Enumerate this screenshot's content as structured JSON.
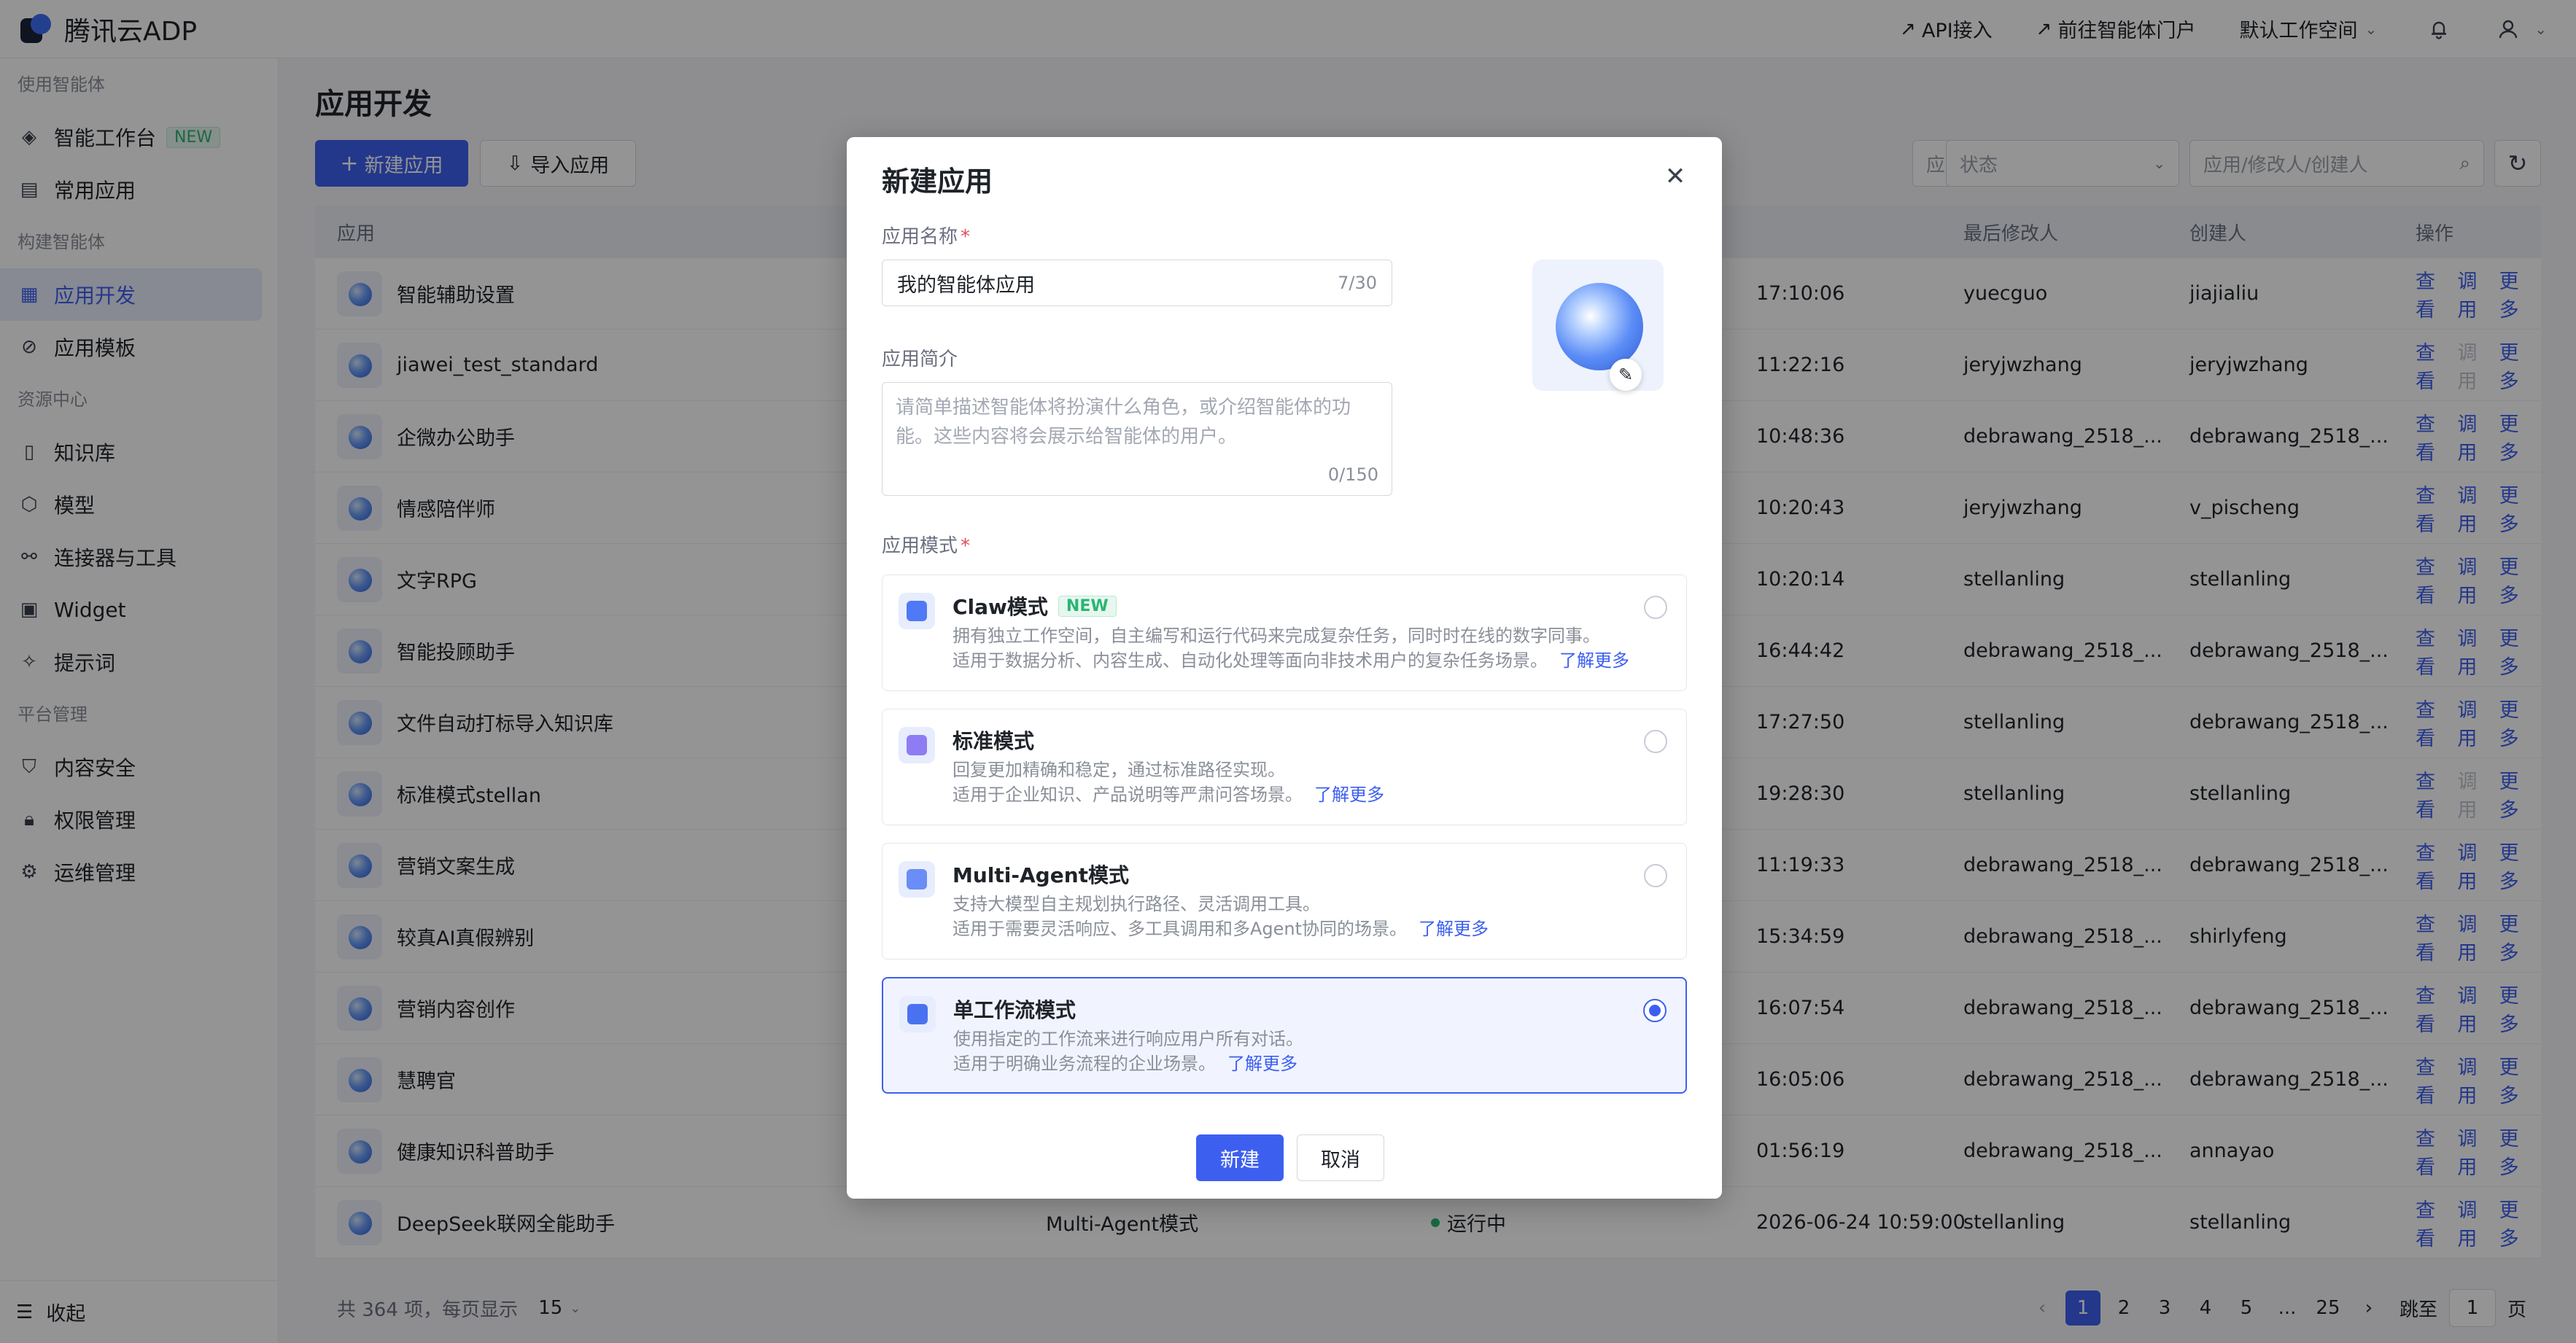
{
  "brand": {
    "name": "腾讯云ADP"
  },
  "topbar": {
    "api_link": "API接入",
    "portal_link": "前往智能体门户",
    "workspace": "默认工作空间"
  },
  "sidebar": {
    "sections": [
      {
        "title": "使用智能体",
        "items": [
          {
            "label": "智能工作台",
            "badge": "NEW",
            "icon": "workbench-icon"
          },
          {
            "label": "常用应用",
            "icon": "list-icon"
          }
        ]
      },
      {
        "title": "构建智能体",
        "items": [
          {
            "label": "应用开发",
            "icon": "grid-icon",
            "active": true
          },
          {
            "label": "应用模板",
            "icon": "template-icon"
          }
        ]
      },
      {
        "title": "资源中心",
        "items": [
          {
            "label": "知识库",
            "icon": "book-icon"
          },
          {
            "label": "模型",
            "icon": "cube-icon"
          },
          {
            "label": "连接器与工具",
            "icon": "link-icon"
          },
          {
            "label": "Widget",
            "icon": "widget-icon"
          },
          {
            "label": "提示词",
            "icon": "sparkle-icon"
          }
        ]
      },
      {
        "title": "平台管理",
        "items": [
          {
            "label": "内容安全",
            "icon": "shield-icon"
          },
          {
            "label": "权限管理",
            "icon": "lock-icon"
          },
          {
            "label": "运维管理",
            "icon": "gear-icon"
          }
        ]
      }
    ],
    "collapse_label": "收起"
  },
  "main": {
    "title": "应用开发",
    "new_app_button": "新建应用",
    "import_button": "导入应用",
    "filter_mode_placeholder": "应用模式",
    "filter_status_placeholder": "状态",
    "search_placeholder": "应用/修改人/创建人",
    "columns": {
      "app": "应用",
      "last_modifier": "最后修改人",
      "creator": "创建人",
      "actions": "操作"
    },
    "action_labels": {
      "view": "查看",
      "debug": "调用",
      "more": "更多"
    },
    "rows": [
      {
        "name": "智能辅助设置",
        "time": "17:10:06",
        "modifier": "yuecguo",
        "creator": "jiajialiu",
        "debug_disabled": false
      },
      {
        "name": "jiawei_test_standard",
        "time": "11:22:16",
        "modifier": "jeryjwzhang",
        "creator": "jeryjwzhang",
        "debug_disabled": true
      },
      {
        "name": "企微办公助手",
        "time": "10:48:36",
        "modifier": "debrawang_2518_...",
        "creator": "debrawang_2518_...",
        "debug_disabled": false
      },
      {
        "name": "情感陪伴师",
        "time": "10:20:43",
        "modifier": "jeryjwzhang",
        "creator": "v_pischeng",
        "debug_disabled": false
      },
      {
        "name": "文字RPG",
        "time": "10:20:14",
        "modifier": "stellanling",
        "creator": "stellanling",
        "debug_disabled": false
      },
      {
        "name": "智能投顾助手",
        "time": "16:44:42",
        "modifier": "debrawang_2518_...",
        "creator": "debrawang_2518_...",
        "debug_disabled": false
      },
      {
        "name": "文件自动打标导入知识库",
        "time": "17:27:50",
        "modifier": "stellanling",
        "creator": "debrawang_2518_...",
        "debug_disabled": false
      },
      {
        "name": "标准模式stellan",
        "time": "19:28:30",
        "modifier": "stellanling",
        "creator": "stellanling",
        "debug_disabled": true
      },
      {
        "name": "营销文案生成",
        "time": "11:19:33",
        "modifier": "debrawang_2518_...",
        "creator": "debrawang_2518_...",
        "debug_disabled": false
      },
      {
        "name": "较真AI真假辨别",
        "time": "15:34:59",
        "modifier": "debrawang_2518_...",
        "creator": "shirlyfeng",
        "debug_disabled": false
      },
      {
        "name": "营销内容创作",
        "time": "16:07:54",
        "modifier": "debrawang_2518_...",
        "creator": "debrawang_2518_...",
        "debug_disabled": false
      },
      {
        "name": "慧聘官",
        "time": "16:05:06",
        "modifier": "debrawang_2518_...",
        "creator": "debrawang_2518_...",
        "debug_disabled": false
      },
      {
        "name": "健康知识科普助手",
        "time": "01:56:19",
        "modifier": "debrawang_2518_...",
        "creator": "annayao",
        "debug_disabled": false
      },
      {
        "name": "DeepSeek联网全能助手",
        "mode": "Multi-Agent模式",
        "status": "运行中",
        "time": "2026-06-24 10:59:00",
        "modifier": "stellanling",
        "creator": "stellanling",
        "debug_disabled": false
      }
    ],
    "pagination": {
      "total_text": "共 364 项，每页显示",
      "page_size": "15",
      "pages": [
        "1",
        "2",
        "3",
        "4",
        "5",
        "...",
        "25"
      ],
      "current": "1",
      "jump_label": "跳至",
      "jump_value": "1",
      "page_suffix": "页"
    }
  },
  "modal": {
    "title": "新建应用",
    "name_label": "应用名称",
    "name_value": "我的智能体应用",
    "name_count": "7/30",
    "desc_label": "应用简介",
    "desc_placeholder": "请简单描述智能体将扮演什么角色，或介绍智能体的功能。这些内容将会展示给智能体的用户。",
    "desc_count": "0/150",
    "mode_label": "应用模式",
    "more_link": "了解更多",
    "modes": [
      {
        "name": "Claw模式",
        "badge": "NEW",
        "line1": "拥有独立工作空间，自主编写和运行代码来完成复杂任务，同时时在线的数字同事。",
        "line2": "适用于数据分析、内容生成、自动化处理等面向非技术用户的复杂任务场景。",
        "selected": false
      },
      {
        "name": "标准模式",
        "line1": "回复更加精确和稳定，通过标准路径实现。",
        "line2": "适用于企业知识、产品说明等严肃问答场景。",
        "selected": false
      },
      {
        "name": "Multi-Agent模式",
        "line1": "支持大模型自主规划执行路径、灵活调用工具。",
        "line2": "适用于需要灵活响应、多工具调用和多Agent协同的场景。",
        "selected": false
      },
      {
        "name": "单工作流模式",
        "line1": "使用指定的工作流来进行响应用户所有对话。",
        "line2": "适用于明确业务流程的企业场景。",
        "selected": true
      }
    ],
    "ok_button": "新建",
    "cancel_button": "取消"
  },
  "colors": {
    "primary": "#3d5ff0",
    "success": "#2bb673",
    "overlay": "rgba(0,0,0,0.42)"
  }
}
